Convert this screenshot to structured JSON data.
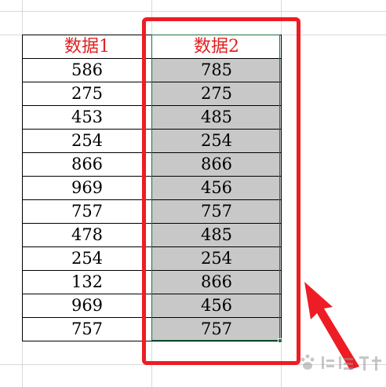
{
  "sheet": {
    "headers": [
      "数据1",
      "数据2"
    ],
    "rows": [
      [
        "586",
        "785"
      ],
      [
        "275",
        "275"
      ],
      [
        "453",
        "485"
      ],
      [
        "254",
        "254"
      ],
      [
        "866",
        "866"
      ],
      [
        "969",
        "456"
      ],
      [
        "757",
        "757"
      ],
      [
        "478",
        "485"
      ],
      [
        "254",
        "254"
      ],
      [
        "132",
        "866"
      ],
      [
        "969",
        "456"
      ],
      [
        "757",
        "757"
      ]
    ],
    "selected_column": 1
  },
  "annotation": {
    "highlight_color": "#ee1c24",
    "selection_color": "#1e7145",
    "selection_fill": "#c8c8c8",
    "header_text_color": "#e02020",
    "arrow_icon": "red-arrow-icon"
  },
  "watermark": {
    "logo": "baidu-jingyan-logo"
  }
}
